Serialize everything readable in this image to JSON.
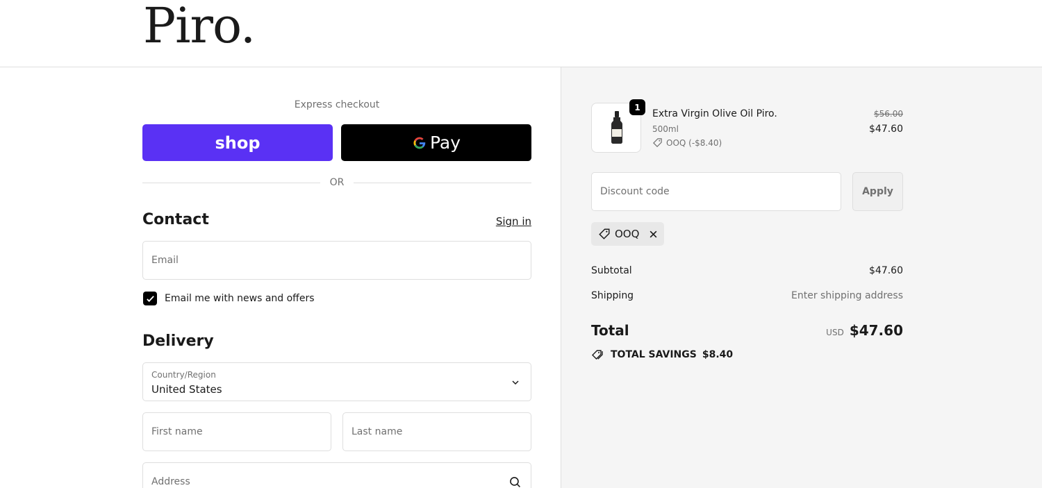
{
  "header": {
    "logo": "Piro."
  },
  "express": {
    "label": "Express checkout",
    "shop_label": "shop",
    "gpay_label": "Pay",
    "or_label": "OR"
  },
  "contact": {
    "heading": "Contact",
    "sign_in": "Sign in",
    "email_placeholder": "Email",
    "newsletter_label": "Email me with news and offers",
    "newsletter_checked": true
  },
  "delivery": {
    "heading": "Delivery",
    "country_label": "Country/Region",
    "country_value": "United States",
    "first_name_placeholder": "First name",
    "last_name_placeholder": "Last name",
    "address_placeholder": "Address"
  },
  "summary": {
    "product": {
      "name": "Extra Virgin Olive Oil Piro.",
      "variant": "500ml",
      "discount": "OOQ (-$8.40)",
      "quantity": "1",
      "price_original": "$56.00",
      "price_final": "$47.60"
    },
    "discount_placeholder": "Discount code",
    "apply_label": "Apply",
    "applied_code": "OOQ",
    "subtotal_label": "Subtotal",
    "subtotal_value": "$47.60",
    "shipping_label": "Shipping",
    "shipping_value": "Enter shipping address",
    "total_label": "Total",
    "total_currency": "USD",
    "total_value": "$47.60",
    "savings_label": "TOTAL SAVINGS",
    "savings_value": "$8.40"
  },
  "colors": {
    "shop_pay": "#5a31f4",
    "gpay": "#000000",
    "summary_bg": "#f5f5f5"
  }
}
